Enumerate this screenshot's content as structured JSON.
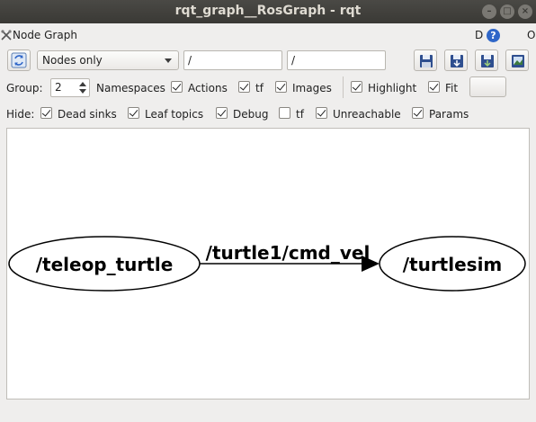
{
  "window": {
    "title": "rqt_graph__RosGraph - rqt",
    "buttons": {
      "minimize": "–",
      "maximize": "□",
      "close": "×"
    }
  },
  "plugin": {
    "title": "Node Graph",
    "d_label": "D",
    "help_label": "?",
    "o_label": "O"
  },
  "toolbar": {
    "refresh_icon": "refresh-icon",
    "mode_selected": "Nodes only",
    "namespace_filter": "/",
    "topic_filter": "/",
    "buttons": [
      "load-dot-icon",
      "save-dot-icon",
      "save-svg-icon",
      "save-image-icon"
    ]
  },
  "options": {
    "group_label": "Group:",
    "group_value": "2",
    "namespaces": {
      "label": "Namespaces",
      "checked": true
    },
    "actions": {
      "label": "Actions",
      "checked": true
    },
    "tf": {
      "label": "tf",
      "checked": true
    },
    "images": {
      "label": "Images",
      "checked": true
    },
    "highlight": {
      "label": "Highlight",
      "checked": true
    },
    "fit": {
      "label": "Fit",
      "checked": true
    }
  },
  "hide": {
    "label": "Hide:",
    "dead_sinks": {
      "label": "Dead sinks",
      "checked": true
    },
    "leaf_topics": {
      "label": "Leaf topics",
      "checked": true
    },
    "debug": {
      "label": "Debug",
      "checked": true
    },
    "tf": {
      "label": "tf",
      "checked": false
    },
    "unreachable": {
      "label": "Unreachable",
      "checked": true
    },
    "params": {
      "label": "Params",
      "checked": true
    }
  },
  "graph": {
    "nodes": [
      {
        "id": "teleop",
        "label": "/teleop_turtle"
      },
      {
        "id": "turtlesim",
        "label": "/turtlesim"
      }
    ],
    "edges": [
      {
        "from": "teleop",
        "to": "turtlesim",
        "label": "/turtle1/cmd_vel"
      }
    ]
  }
}
